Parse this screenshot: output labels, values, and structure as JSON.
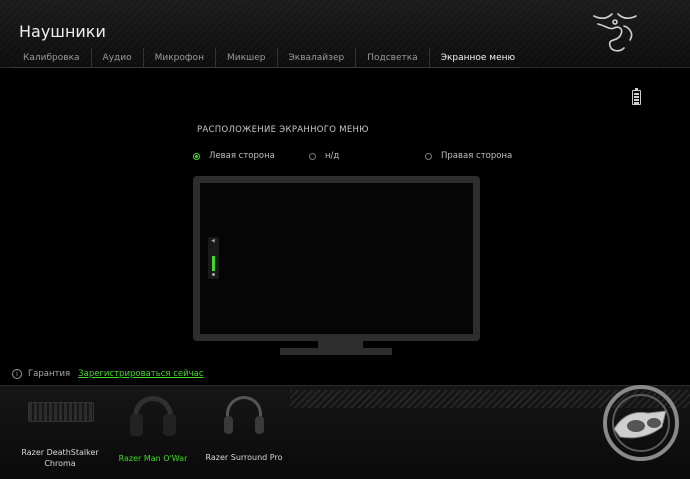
{
  "header": {
    "title": "Наушники",
    "tabs": [
      {
        "label": "Калибровка",
        "active": false
      },
      {
        "label": "Аудио",
        "active": false
      },
      {
        "label": "Микрофон",
        "active": false
      },
      {
        "label": "Микшер",
        "active": false
      },
      {
        "label": "Эквалайзер",
        "active": false
      },
      {
        "label": "Подсветка",
        "active": false
      },
      {
        "label": "Экранное меню",
        "active": true
      }
    ]
  },
  "osd_position": {
    "title": "РАСПОЛОЖЕНИЕ ЭКРАННОГО МЕНЮ",
    "options": [
      {
        "label": "Левая сторона",
        "selected": true
      },
      {
        "label": "н/д",
        "selected": false
      },
      {
        "label": "Правая сторона",
        "selected": false
      }
    ]
  },
  "warranty": {
    "label": "Гарантия",
    "link": "Зарегистрироваться сейчас"
  },
  "devices": [
    {
      "name": "Razer DeathStalker Chroma",
      "active": false
    },
    {
      "name": "Razer Man O'War",
      "active": true
    },
    {
      "name": "Razer Surround Pro",
      "active": false
    }
  ],
  "colors": {
    "accent": "#44d62c",
    "background": "#000000",
    "panel": "#2d2d2d"
  },
  "icons": {
    "logo": "razer-snake-logo",
    "battery": "battery-icon",
    "info": "info-icon"
  }
}
